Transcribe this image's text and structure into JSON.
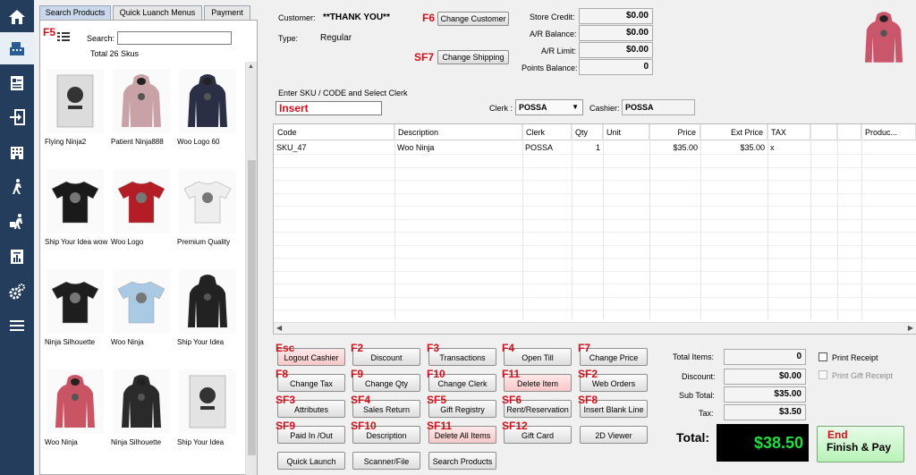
{
  "nav": {
    "items": [
      {
        "icon": "home-icon",
        "active": false
      },
      {
        "icon": "register-icon",
        "active": true
      },
      {
        "icon": "invoice-icon",
        "active": false
      },
      {
        "icon": "sign-in-icon",
        "active": false
      },
      {
        "icon": "building-icon",
        "active": false
      },
      {
        "icon": "person-walk-icon",
        "active": false
      },
      {
        "icon": "delivery-icon",
        "active": false
      },
      {
        "icon": "report-icon",
        "active": false
      },
      {
        "icon": "settings-icon",
        "active": false
      },
      {
        "icon": "menu-icon",
        "active": false
      }
    ]
  },
  "left": {
    "tabs": [
      "Search Products",
      "Quick Luanch Menus",
      "Payment"
    ],
    "f5_key": "F5",
    "search_label": "Search:",
    "search_value": "",
    "total": "Total 26 Skus",
    "products": [
      {
        "name": "Flying Ninja2",
        "kind": "poster",
        "color": "#dcdcdc"
      },
      {
        "name": "Patient Ninja888",
        "kind": "hoodie",
        "color": "#c8a2a6"
      },
      {
        "name": "Woo Logo 60",
        "kind": "hoodie",
        "color": "#2b2f45"
      },
      {
        "name": "Ship Your Idea wow",
        "kind": "tshirt",
        "color": "#1a1a1a"
      },
      {
        "name": "Woo Logo",
        "kind": "tshirt",
        "color": "#b31d26"
      },
      {
        "name": "Premium Quality",
        "kind": "tshirt",
        "color": "#eeeeee"
      },
      {
        "name": "Ninja Silhouette",
        "kind": "tshirt",
        "color": "#1e1e1e"
      },
      {
        "name": "Woo Ninja",
        "kind": "tshirt",
        "color": "#aac9e2"
      },
      {
        "name": "Ship Your Idea",
        "kind": "hoodie",
        "color": "#222222"
      },
      {
        "name": "Woo Ninja",
        "kind": "hoodie",
        "color": "#c95464"
      },
      {
        "name": "Ninja Silhouette",
        "kind": "hoodie",
        "color": "#2a2a2a"
      },
      {
        "name": "Ship Your Idea",
        "kind": "poster",
        "color": "#e3e3e3"
      }
    ]
  },
  "header": {
    "customer_label": "Customer:",
    "customer_value": "**THANK YOU**",
    "type_label": "Type:",
    "type_value": "Regular",
    "f6_key": "F6",
    "change_customer": "Change Customer",
    "sf7_key": "SF7",
    "change_shipping": "Change Shipping",
    "store_credit_label": "Store Credit:",
    "store_credit": "$0.00",
    "ar_balance_label": "A/R Balance:",
    "ar_balance": "$0.00",
    "ar_limit_label": "A/R Limit:",
    "ar_limit": "$0.00",
    "points_label": "Points Balance:",
    "points": "0",
    "sku_label": "Enter SKU / CODE and Select Clerk",
    "sku_value": "Insert",
    "clerk_label": "Clerk :",
    "clerk_value": "POSSA",
    "cashier_label": "Cashier:",
    "cashier_value": "POSSA",
    "thumb_color": "#c9566a"
  },
  "grid": {
    "columns": [
      "Code",
      "Description",
      "Clerk",
      "Qty",
      "Unit",
      "Price",
      "Ext Price",
      "TAX",
      "",
      "",
      "Produc..."
    ],
    "rows": [
      [
        "SKU_47",
        "Woo Ninja",
        "POSSA",
        "1",
        "",
        "$35.00",
        "$35.00",
        "x",
        "",
        "",
        ""
      ]
    ]
  },
  "actions": [
    {
      "key": "Esc",
      "label": "Logout Cashier",
      "pink": true
    },
    {
      "key": "F2",
      "label": "Discount",
      "pink": false
    },
    {
      "key": "F3",
      "label": "Transactions",
      "pink": false
    },
    {
      "key": "F4",
      "label": "Open Till",
      "pink": false
    },
    {
      "key": "F7",
      "label": "Change Price",
      "pink": false
    },
    {
      "key": "F8",
      "label": "Change Tax",
      "pink": false
    },
    {
      "key": "F9",
      "label": "Change Qty",
      "pink": false
    },
    {
      "key": "F10",
      "label": "Change Clerk",
      "pink": false
    },
    {
      "key": "F11",
      "label": "Delete Item",
      "pink": true
    },
    {
      "key": "SF2",
      "label": "Web Orders",
      "pink": false
    },
    {
      "key": "SF3",
      "label": "Attributes",
      "pink": false
    },
    {
      "key": "SF4",
      "label": "Sales Return",
      "pink": false
    },
    {
      "key": "SF5",
      "label": "Gift Registry",
      "pink": false
    },
    {
      "key": "SF6",
      "label": "Rent/Reservation",
      "pink": false
    },
    {
      "key": "SF8",
      "label": "Insert Blank Line",
      "pink": false
    },
    {
      "key": "SF9",
      "label": "Paid In /Out",
      "pink": false
    },
    {
      "key": "SF10",
      "label": "Description",
      "pink": false
    },
    {
      "key": "SF11",
      "label": "Delete All Items",
      "pink": true
    },
    {
      "key": "SF12",
      "label": "Gift Card",
      "pink": false
    },
    {
      "key": "",
      "label": "2D Viewer",
      "pink": false
    },
    {
      "key": "",
      "label": "Quick Launch",
      "pink": false
    },
    {
      "key": "",
      "label": "Scanner/File",
      "pink": false
    },
    {
      "key": "",
      "label": "Search Products",
      "pink": false
    }
  ],
  "totals": {
    "items_label": "Total Items:",
    "items": "0",
    "discount_label": "Discount:",
    "discount": "$0.00",
    "subtotal_label": "Sub Total:",
    "subtotal": "$35.00",
    "tax_label": "Tax:",
    "tax": "$3.50",
    "total_label": "Total:",
    "total": "$38.50",
    "print_receipt": "Print Receipt",
    "print_gift_receipt": "Print Gift Receipt",
    "end_key": "End",
    "finish_pay": "Finish & Pay"
  }
}
